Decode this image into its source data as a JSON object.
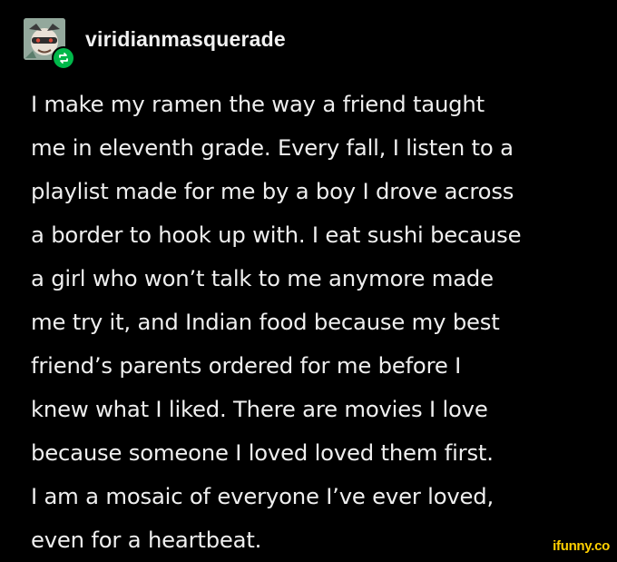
{
  "post": {
    "username": "viridianmasquerade",
    "avatar_icon": "masked-character-avatar-icon",
    "reblog_icon": "reblog-icon",
    "reblog_color": "#00b84a",
    "lines": [
      "I make my ramen the way a friend taught",
      "me in eleventh grade. Every fall, I listen to a",
      "playlist made for me by a boy I drove across",
      "a border to hook up with. I eat sushi because",
      "a girl who won’t talk to me anymore made",
      "me try it, and Indian food because my best",
      "friend’s parents ordered for me before I",
      "knew what I liked. There are movies I love",
      "because someone I loved loved them first.",
      "I am a mosaic of everyone I’ve ever loved,",
      "even for a heartbeat."
    ]
  },
  "watermark": {
    "text": "ifunny.co",
    "color": "#ffd000"
  }
}
